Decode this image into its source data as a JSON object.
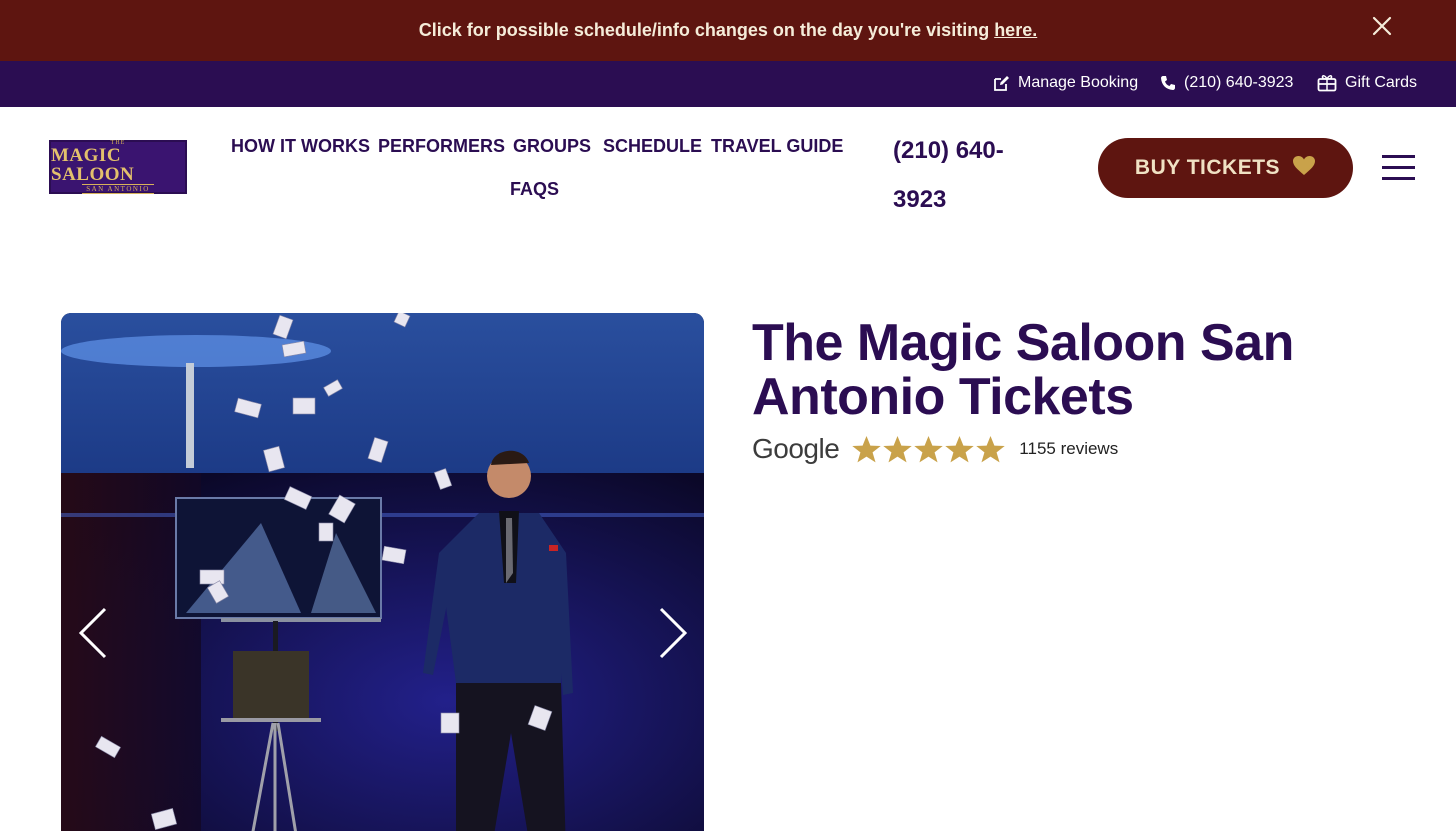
{
  "announcement": {
    "text": "Click for possible schedule/info changes on the day you're visiting ",
    "link_label": "here."
  },
  "utility_bar": {
    "manage_booking": "Manage Booking",
    "phone": "(210) 640-3923",
    "gift_cards": "Gift Cards"
  },
  "logo": {
    "small_text": "THE",
    "main_text": "MAGIC SALOON",
    "sub_text": "SAN ANTONIO"
  },
  "nav": {
    "items": [
      "HOW IT WORKS",
      "PERFORMERS",
      "GROUPS",
      "SCHEDULE",
      "TRAVEL GUIDE",
      "FAQS"
    ]
  },
  "header": {
    "phone_line1": "(210) 640-",
    "phone_line2": "3923",
    "buy_button": "BUY TICKETS"
  },
  "hero": {
    "title": "The Magic Saloon San Antonio Tickets",
    "rating_source": "Google",
    "rating_stars": 5,
    "review_count": "1155 reviews"
  },
  "colors": {
    "announcement_bg": "#5e1510",
    "utility_bg": "#2b0d52",
    "brand_purple": "#2b0d52",
    "brand_gold": "#c9a24a",
    "button_bg": "#5e1510"
  },
  "icons": [
    "close-icon",
    "edit-icon",
    "phone-icon",
    "gift-icon",
    "heart-icon",
    "hamburger-icon",
    "chevron-left-icon",
    "chevron-right-icon",
    "star-icon"
  ]
}
